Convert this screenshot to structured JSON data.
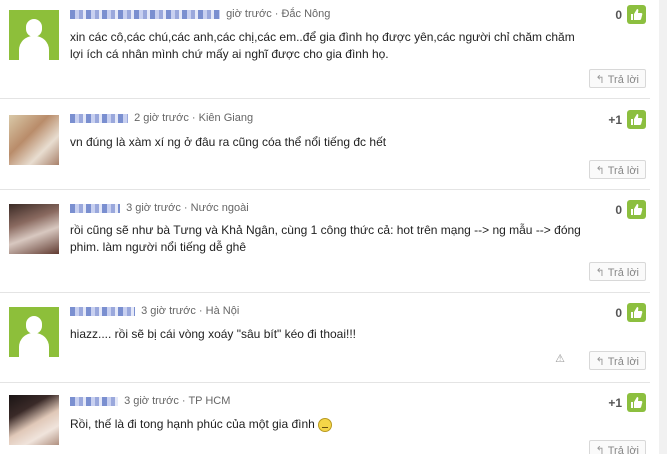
{
  "comments": [
    {
      "time": "giờ trước",
      "location": "Đắc Nông",
      "text": "xin các cô,các chú,các anh,các chị,các em..để gia đình họ được yên,các người chỉ chăm chăm lợi ích cá nhân mình chứ mấy ai nghĩ được cho gia đình họ.",
      "votes": "0",
      "reply_label": "Trả lời",
      "avatar": "default-avatar"
    },
    {
      "time": "2 giờ trước",
      "location": "Kiên Giang",
      "text": "vn đúng là xàm xí ng ở đâu ra cũng cóa thể nổi tiếng đc hết",
      "votes": "+1",
      "reply_label": "Trả lời",
      "avatar": "photo-avatar"
    },
    {
      "time": "3 giờ trước",
      "location": "Nước ngoài",
      "text": "rồi cũng sẽ như bà Tưng và Khả Ngân, cùng 1 công thức cả: hot trên mạng --> ng mẫu --> đóng phim. làm người nổi tiếng dễ ghê",
      "votes": "0",
      "reply_label": "Trả lời",
      "avatar": "photo-avatar"
    },
    {
      "time": "3 giờ trước",
      "location": "Hà Nội",
      "text": "hiazz.... rồi sẽ bị cái vòng xoáy \"sâu bít\" kéo đi thoai!!!",
      "votes": "0",
      "reply_label": "Trả lời",
      "avatar": "default-avatar"
    },
    {
      "time": "3 giờ trước",
      "location": "TP HCM",
      "text": "Rồi, thế là đi tong hạnh phúc của một gia đình",
      "votes": "+1",
      "reply_label": "Trả lời",
      "avatar": "photo-avatar"
    }
  ],
  "icons": {
    "like": "thumbs-up-icon",
    "reply": "reply-arrow-icon",
    "report": "warning-icon",
    "emoticon": "sad-face-icon"
  },
  "colors": {
    "like_button": "#8cbf3f",
    "default_avatar": "#8dbf3a"
  }
}
